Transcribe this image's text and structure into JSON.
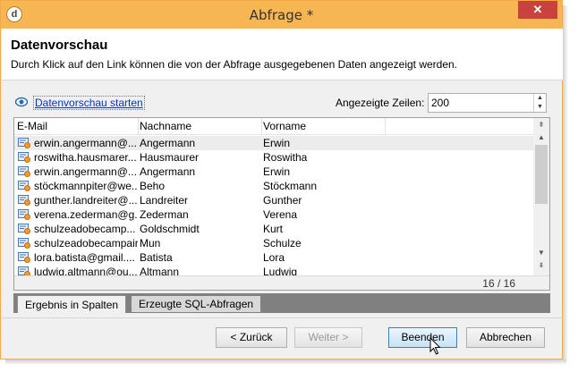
{
  "window": {
    "title": "Abfrage *",
    "close_glyph": "✕",
    "app_icon_glyph": "d"
  },
  "header": {
    "title": "Datenvorschau",
    "description": "Durch Klick auf den Link können die von der Abfrage ausgegebenen Daten angezeigt werden."
  },
  "toolbar": {
    "preview_link": "Datenvorschau starten",
    "rows_label": "Angezeigte Zeilen:",
    "rows_value": "200"
  },
  "grid": {
    "columns": [
      "E-Mail",
      "Nachname",
      "Vorname"
    ],
    "rows": [
      {
        "email": "erwin.angermann@...",
        "lastname": "Angermann",
        "firstname": "Erwin"
      },
      {
        "email": "roswitha.hausmarer...",
        "lastname": "Hausmaurer",
        "firstname": "Roswitha"
      },
      {
        "email": "erwin.angermann@...",
        "lastname": "Angermann",
        "firstname": "Erwin"
      },
      {
        "email": "stöckmannpiter@we...",
        "lastname": "Beho",
        "firstname": "Stöckmann"
      },
      {
        "email": "gunther.landreiter@...",
        "lastname": "Landreiter",
        "firstname": "Gunther"
      },
      {
        "email": "verena.zederman@g...",
        "lastname": "Zederman",
        "firstname": "Verena"
      },
      {
        "email": "schulzeadobecamp...",
        "lastname": "Goldschmidt",
        "firstname": "Kurt"
      },
      {
        "email": "schulzeadobecampair",
        "lastname": "Mun",
        "firstname": "Schulze"
      },
      {
        "email": "lora.batista@gmail....",
        "lastname": "Batista",
        "firstname": "Lora"
      },
      {
        "email": "ludwig.altmann@ou...",
        "lastname": "Altmann",
        "firstname": "Ludwig"
      }
    ],
    "count": "16 / 16"
  },
  "tabs": [
    "Ergebnis in Spalten",
    "Erzeugte SQL-Abfragen"
  ],
  "buttons": {
    "back": "< Zurück",
    "next": "Weiter >",
    "finish": "Beenden",
    "cancel": "Abbrechen"
  },
  "colors": {
    "titlebar": "#f7b654",
    "close": "#c7433c",
    "link": "#0033cc"
  }
}
